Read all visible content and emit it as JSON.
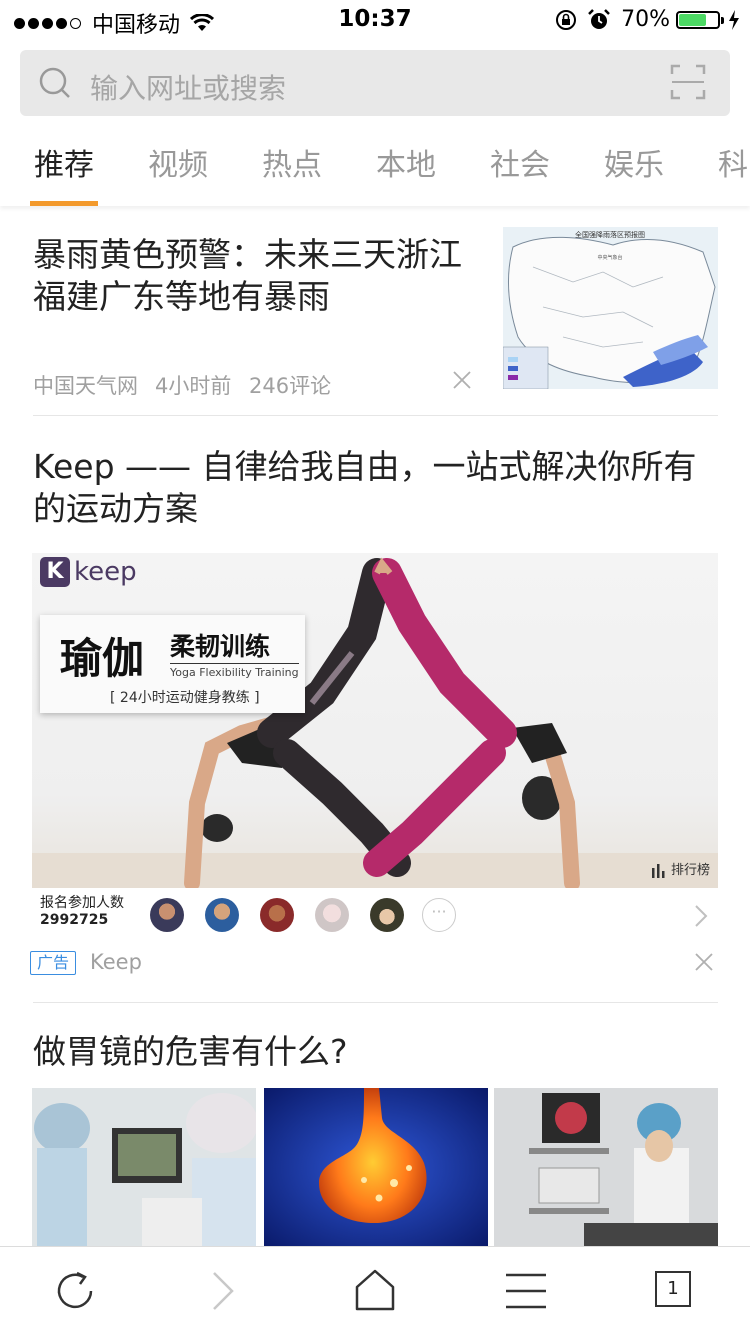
{
  "status_bar": {
    "carrier": "中国移动",
    "time": "10:37",
    "battery": "70%",
    "battery_level": 0.7,
    "signal_bars": 4
  },
  "search": {
    "placeholder": "输入网址或搜索"
  },
  "tabs": {
    "items": [
      "推荐",
      "视频",
      "热点",
      "本地",
      "社会",
      "娱乐",
      "科"
    ],
    "active_index": 0,
    "active_color": "#f39a2d"
  },
  "article1": {
    "title": "暴雨黄色预警：未来三天浙江福建广东等地有暴雨",
    "source": "中国天气网",
    "time": "4小时前",
    "comments": "246评论",
    "thumb_title": "全国强降雨落区预报图",
    "thumb_sub": "中央气象台"
  },
  "ad": {
    "title": "Keep —— 自律给我自由，一站式解决你所有的运动方案",
    "logo_letter": "K",
    "logo_text": "keep",
    "banner_title": "瑜伽",
    "banner_subtitle": "柔韧训练",
    "banner_en": "Yoga Flexibility Training",
    "banner_note": "[ 24小时运动健身教练 ]",
    "rank_label": "排行榜",
    "signup_label": "报名参加人数",
    "signup_count": "2992725",
    "more_symbol": "···",
    "badge": "广告",
    "source": "Keep"
  },
  "article3": {
    "title": "做胃镜的危害有什么?"
  },
  "bottom_bar": {
    "tab_count": "1"
  }
}
